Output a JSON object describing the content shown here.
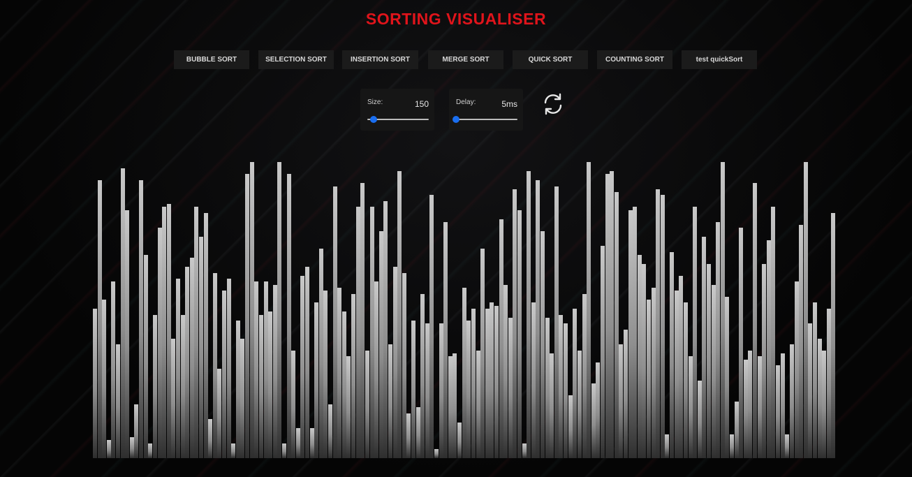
{
  "title": "SORTING VISUALISER",
  "algorithms": [
    {
      "label": "BUBBLE SORT"
    },
    {
      "label": "SELECTION SORT"
    },
    {
      "label": "INSERTION SORT"
    },
    {
      "label": "MERGE SORT"
    },
    {
      "label": "QUICK SORT"
    },
    {
      "label": "COUNTING SORT"
    },
    {
      "label": "test quickSort"
    }
  ],
  "size_control": {
    "label": "Size:",
    "value": "150",
    "level": 0.1
  },
  "delay_control": {
    "label": "Delay:",
    "value": "5ms",
    "level": 0.0
  },
  "reset_icon": "refresh-icon",
  "colors": {
    "title": "#e0141b",
    "slider_thumb": "#1a6ef0",
    "button_bg": "#1b1b1b"
  },
  "array_values": [
    50,
    93,
    53,
    6,
    59,
    38,
    97,
    83,
    7,
    18,
    93,
    68,
    5,
    48,
    77,
    84,
    85,
    40,
    60,
    48,
    64,
    67,
    84,
    74,
    82,
    13,
    62,
    30,
    56,
    60,
    5,
    46,
    40,
    95,
    99,
    59,
    48,
    59,
    49,
    58,
    99,
    5,
    95,
    36,
    10,
    61,
    64,
    10,
    52,
    70,
    56,
    18,
    91,
    57,
    49,
    34,
    55,
    84,
    92,
    36,
    84,
    59,
    76,
    86,
    38,
    64,
    96,
    62,
    15,
    46,
    17,
    55,
    45,
    88,
    3,
    45,
    79,
    34,
    35,
    12,
    57,
    46,
    50,
    36,
    70,
    50,
    52,
    51,
    80,
    58,
    47,
    90,
    83,
    5,
    96,
    52,
    93,
    76,
    47,
    35,
    91,
    48,
    45,
    21,
    50,
    36,
    55,
    99,
    25,
    32,
    71,
    95,
    96,
    89,
    38,
    43,
    83,
    84,
    68,
    65,
    53,
    57,
    90,
    88,
    8,
    69,
    56,
    61,
    52,
    34,
    84,
    26,
    74,
    65,
    58,
    79,
    99,
    54,
    8,
    19,
    77,
    33,
    36,
    92,
    34,
    65,
    73,
    84,
    31,
    35,
    8,
    38,
    59,
    78,
    99,
    45,
    52,
    40,
    36,
    50,
    82
  ]
}
